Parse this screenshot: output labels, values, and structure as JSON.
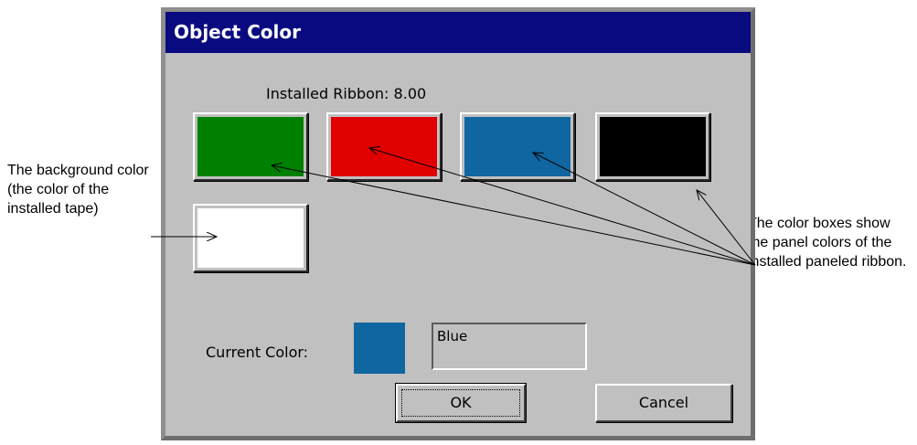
{
  "callouts": {
    "left": "The background color (the color of the installed tape)",
    "right": "The color boxes show the panel colors of the installed paneled ribbon."
  },
  "dialog": {
    "title": "Object Color",
    "installed_label": "Installed Ribbon:",
    "installed_value": "8.00",
    "swatches": [
      {
        "name": "green",
        "color": "#008000"
      },
      {
        "name": "red",
        "color": "#e00000"
      },
      {
        "name": "blue",
        "color": "#0f66a0"
      },
      {
        "name": "black",
        "color": "#000000"
      },
      {
        "name": "white",
        "color": "#ffffff"
      }
    ],
    "current_color_label": "Current Color:",
    "current_color": "#0f66a0",
    "current_color_name": "Blue",
    "ok_label": "OK",
    "cancel_label": "Cancel"
  }
}
